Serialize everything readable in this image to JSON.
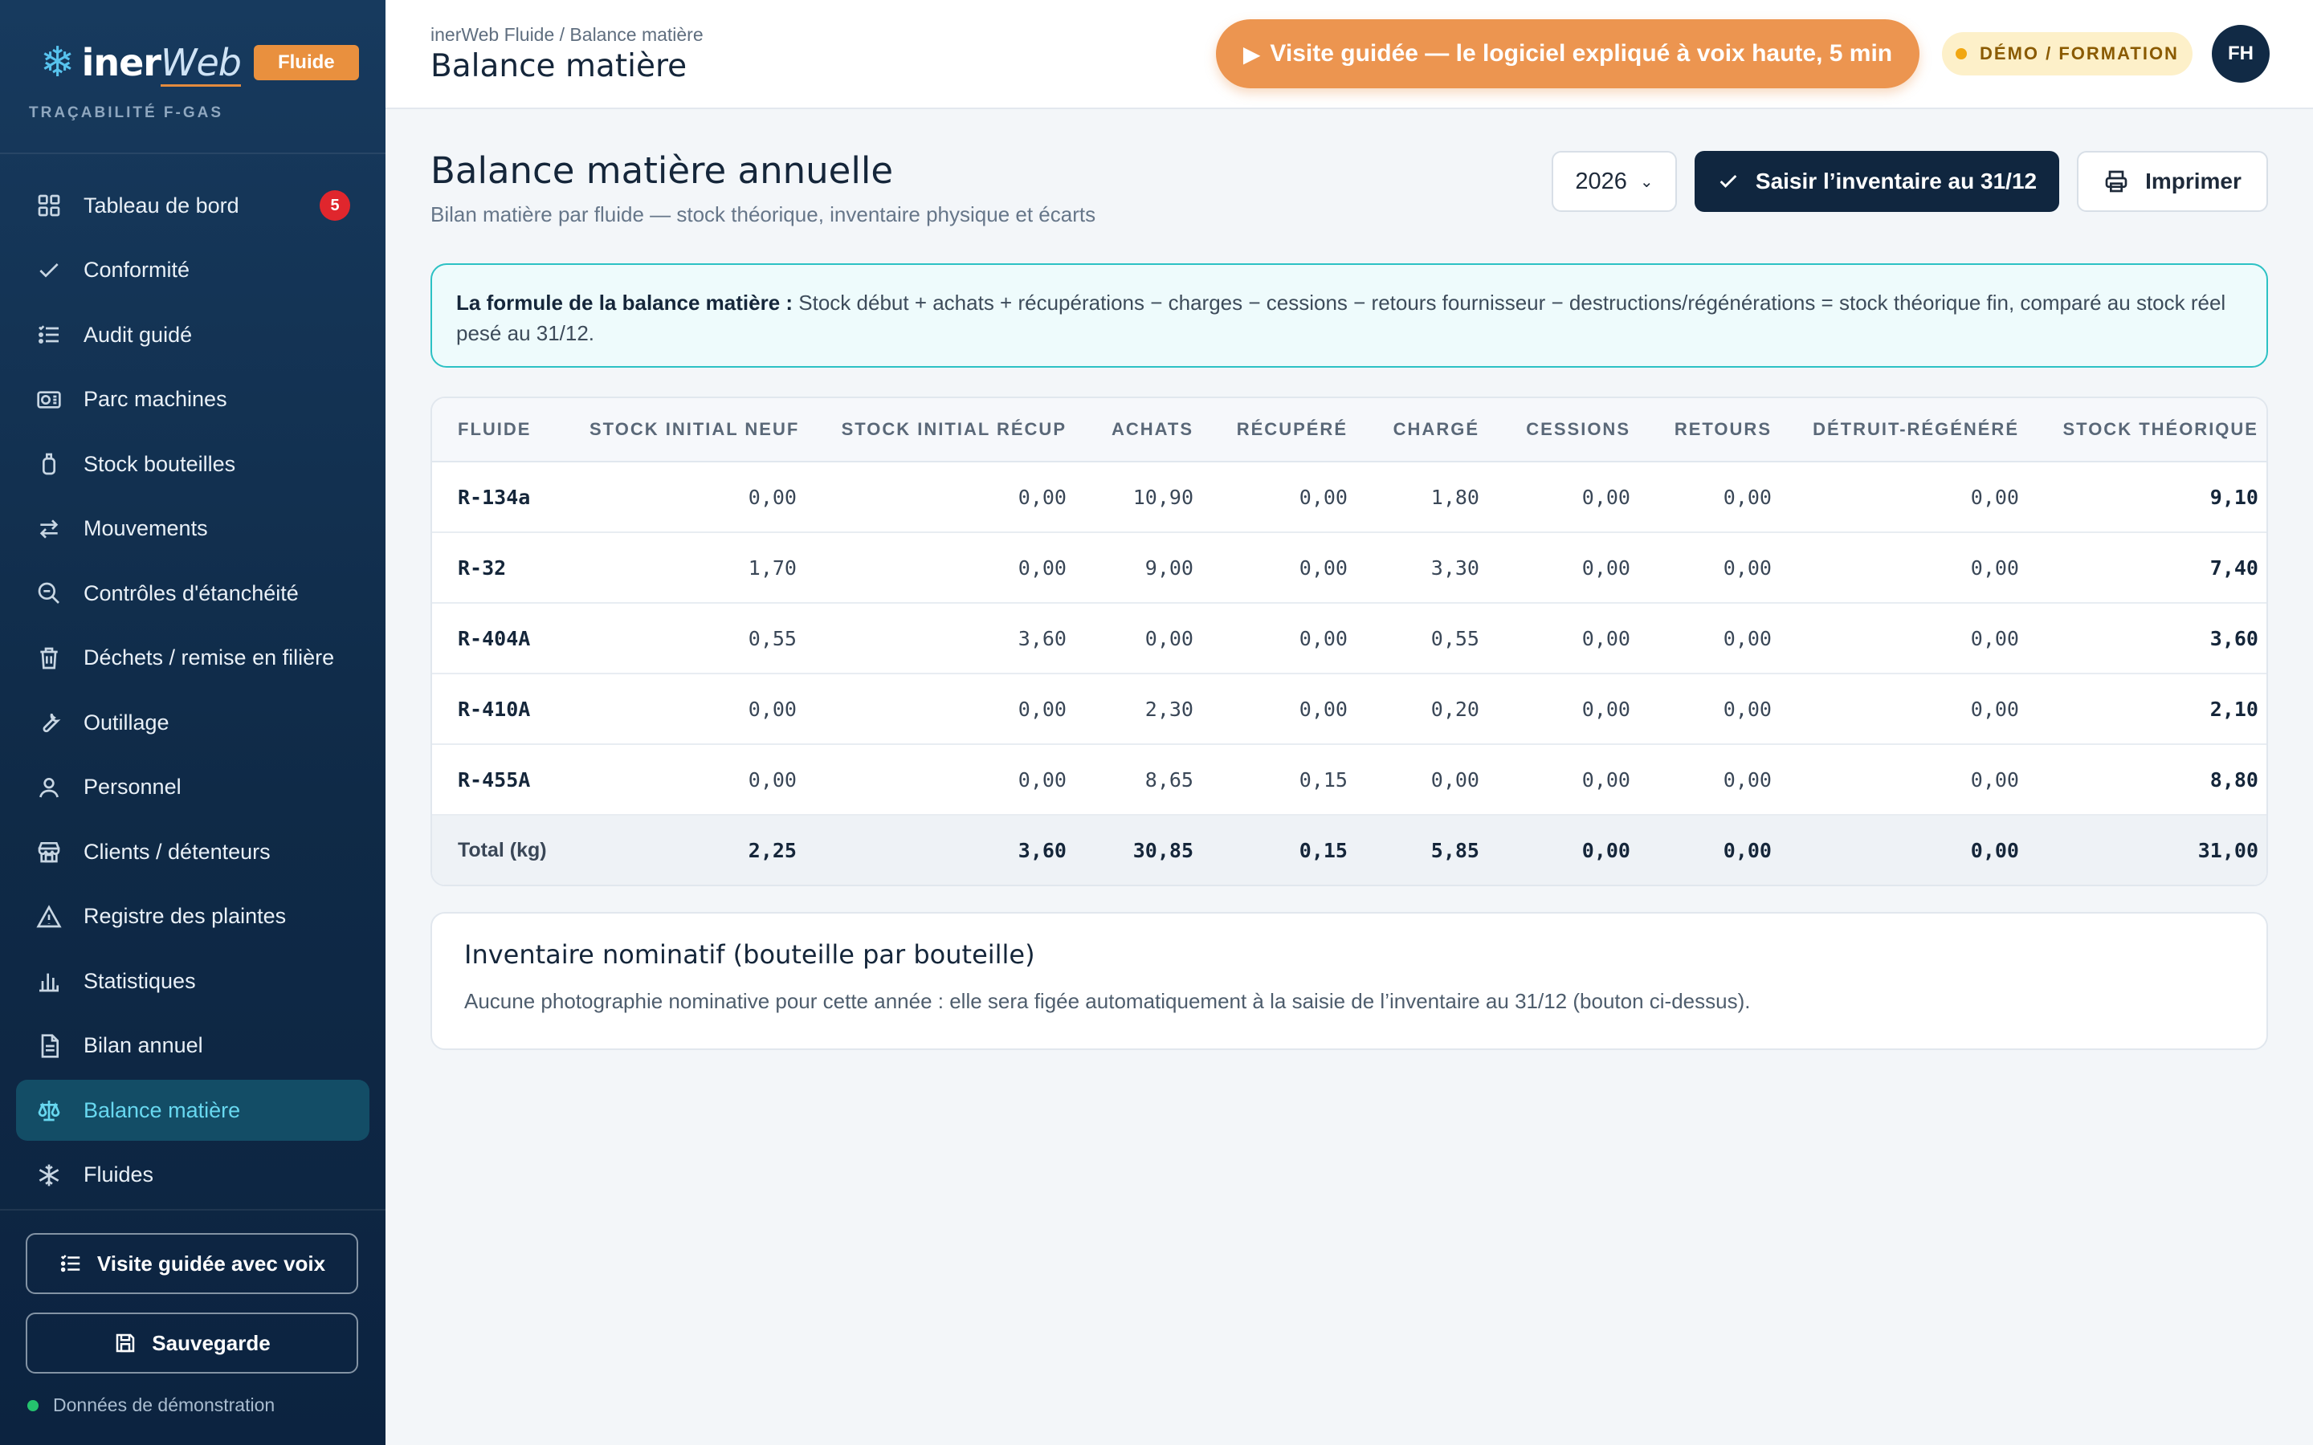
{
  "brand": {
    "name": "inerWeb",
    "badge": "Fluide",
    "tagline": "TRAÇABILITÉ F-GAS"
  },
  "sidebar": {
    "items": [
      {
        "label": "Tableau de bord",
        "icon": "grid-icon",
        "count": "5"
      },
      {
        "label": "Conformité",
        "icon": "check-icon"
      },
      {
        "label": "Audit guidé",
        "icon": "list-icon"
      },
      {
        "label": "Parc machines",
        "icon": "unit-icon"
      },
      {
        "label": "Stock bouteilles",
        "icon": "bottle-icon"
      },
      {
        "label": "Mouvements",
        "icon": "swap-icon"
      },
      {
        "label": "Contrôles d'étanchéité",
        "icon": "search-icon"
      },
      {
        "label": "Déchets / remise en filière",
        "icon": "trash-icon"
      },
      {
        "label": "Outillage",
        "icon": "wrench-icon"
      },
      {
        "label": "Personnel",
        "icon": "user-icon"
      },
      {
        "label": "Clients / détenteurs",
        "icon": "store-icon"
      },
      {
        "label": "Registre des plaintes",
        "icon": "warning-icon"
      },
      {
        "label": "Statistiques",
        "icon": "bar-chart-icon"
      },
      {
        "label": "Bilan annuel",
        "icon": "document-icon"
      },
      {
        "label": "Balance matière",
        "icon": "scale-icon",
        "active": true
      },
      {
        "label": "Fluides",
        "icon": "snowflake-icon"
      }
    ],
    "guided_tour_button": "Visite guidée avec voix",
    "backup_button": "Sauvegarde",
    "status_text": "Données de démonstration"
  },
  "topbar": {
    "breadcrumb": "inerWeb Fluide / Balance matière",
    "title": "Balance matière",
    "tour_button": "Visite guidée — le logiciel expliqué à voix haute, 5 min",
    "demo_badge": "DÉMO / FORMATION",
    "avatar_initials": "FH"
  },
  "page": {
    "title": "Balance matière annuelle",
    "subtitle": "Bilan matière par fluide — stock théorique, inventaire physique et écarts",
    "year_selected": "2026",
    "inventory_button": "Saisir l’inventaire au 31/12",
    "print_button": "Imprimer"
  },
  "formula": {
    "label": "La formule de la balance matière :",
    "text": "Stock début + achats + récupérations − charges − cessions − retours fournisseur − destructions/régénérations = stock théorique fin, comparé au stock réel pesé au 31/12."
  },
  "table": {
    "headers": [
      "FLUIDE",
      "STOCK INITIAL NEUF",
      "STOCK INITIAL RÉCUP",
      "ACHATS",
      "RÉCUPÉRÉ",
      "CHARGÉ",
      "CESSIONS",
      "RETOURS",
      "DÉTRUIT-RÉGÉNÉRÉ",
      "STOCK THÉORIQUE"
    ],
    "rows": [
      [
        "R-134a",
        "0,00",
        "0,00",
        "10,90",
        "0,00",
        "1,80",
        "0,00",
        "0,00",
        "0,00",
        "9,10"
      ],
      [
        "R-32",
        "1,70",
        "0,00",
        "9,00",
        "0,00",
        "3,30",
        "0,00",
        "0,00",
        "0,00",
        "7,40"
      ],
      [
        "R-404A",
        "0,55",
        "3,60",
        "0,00",
        "0,00",
        "0,55",
        "0,00",
        "0,00",
        "0,00",
        "3,60"
      ],
      [
        "R-410A",
        "0,00",
        "0,00",
        "2,30",
        "0,00",
        "0,20",
        "0,00",
        "0,00",
        "0,00",
        "2,10"
      ],
      [
        "R-455A",
        "0,00",
        "0,00",
        "8,65",
        "0,15",
        "0,00",
        "0,00",
        "0,00",
        "0,00",
        "8,80"
      ]
    ],
    "total": [
      "Total (kg)",
      "2,25",
      "3,60",
      "30,85",
      "0,15",
      "5,85",
      "0,00",
      "0,00",
      "0,00",
      "31,00"
    ]
  },
  "inventory": {
    "title": "Inventaire nominatif (bouteille par bouteille)",
    "text": "Aucune photographie nominative pour cette année : elle sera figée automatiquement à la saisie de l’inventaire au 31/12 (bouton ci-dessus)."
  },
  "colors": {
    "sidebar_bg": "#173a5e",
    "accent_orange": "#ec9550",
    "active_cyan": "#68d8f0",
    "formula_border": "#2cc1c4",
    "primary_dark": "#10263f"
  }
}
